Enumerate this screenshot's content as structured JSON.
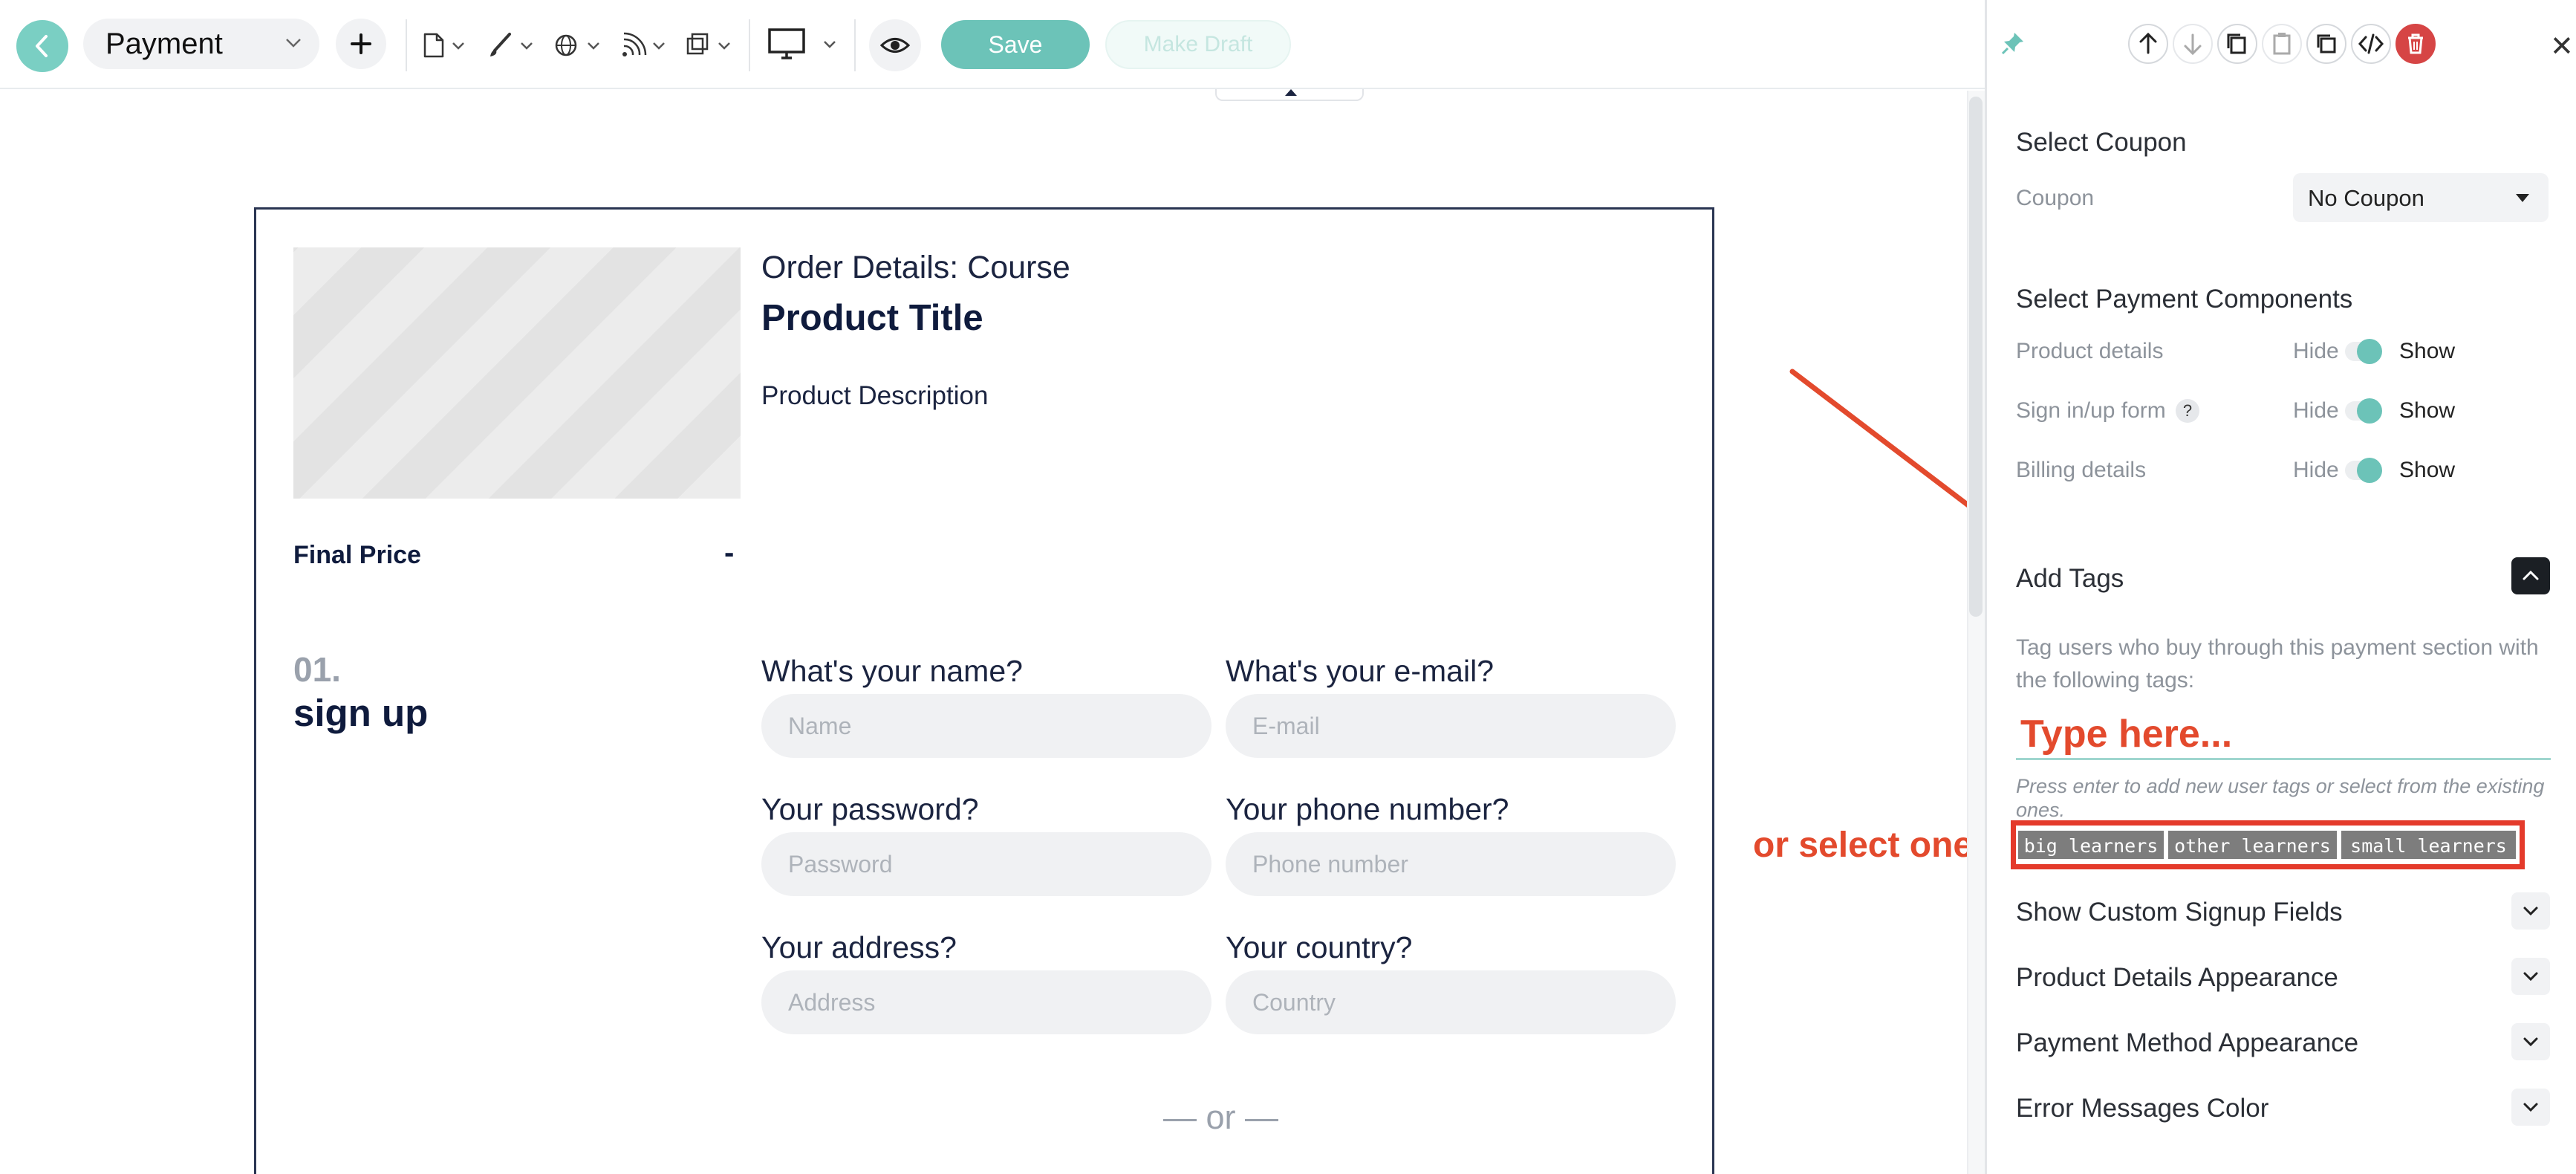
{
  "toolbar": {
    "page_name": "Payment",
    "save_label": "Save",
    "draft_label": "Make Draft"
  },
  "canvas": {
    "order_heading": "Order Details: Course",
    "product_title": "Product Title",
    "product_description": "Product Description",
    "final_price_label": "Final Price",
    "final_price_value": "-",
    "step_number": "01.",
    "step_title": "sign up",
    "fields": [
      {
        "label": "What's your name?",
        "placeholder": "Name"
      },
      {
        "label": "What's your e-mail?",
        "placeholder": "E-mail"
      },
      {
        "label": "Your password?",
        "placeholder": "Password"
      },
      {
        "label": "Your phone number?",
        "placeholder": "Phone number"
      },
      {
        "label": "Your address?",
        "placeholder": "Address"
      },
      {
        "label": "Your country?",
        "placeholder": "Country"
      }
    ],
    "or_separator": "— or —"
  },
  "annotation": {
    "select_hint": "or select one"
  },
  "panel": {
    "coupon_section": {
      "heading": "Select Coupon",
      "label": "Coupon",
      "selected": "No Coupon"
    },
    "components_section": {
      "heading": "Select Payment Components",
      "rows": [
        {
          "label": "Product details",
          "hide": "Hide",
          "show": "Show"
        },
        {
          "label": "Sign in/up form",
          "hide": "Hide",
          "show": "Show",
          "help": "?"
        },
        {
          "label": "Billing details",
          "hide": "Hide",
          "show": "Show"
        }
      ]
    },
    "tags_section": {
      "heading": "Add Tags",
      "description": "Tag users who buy through this payment section with the following tags:",
      "input_placeholder": "Type here...",
      "hint": "Press enter to add new user tags or select from the existing ones.",
      "tags": [
        "big learners",
        "other learners",
        "small learners"
      ]
    },
    "accordions": [
      "Show Custom Signup Fields",
      "Product Details Appearance",
      "Payment Method Appearance",
      "Error Messages Color"
    ]
  },
  "colors": {
    "accent": "#6cc3b8",
    "annotation": "#e34a2d",
    "delete": "#d64545",
    "heading": "#0f1b3d"
  }
}
